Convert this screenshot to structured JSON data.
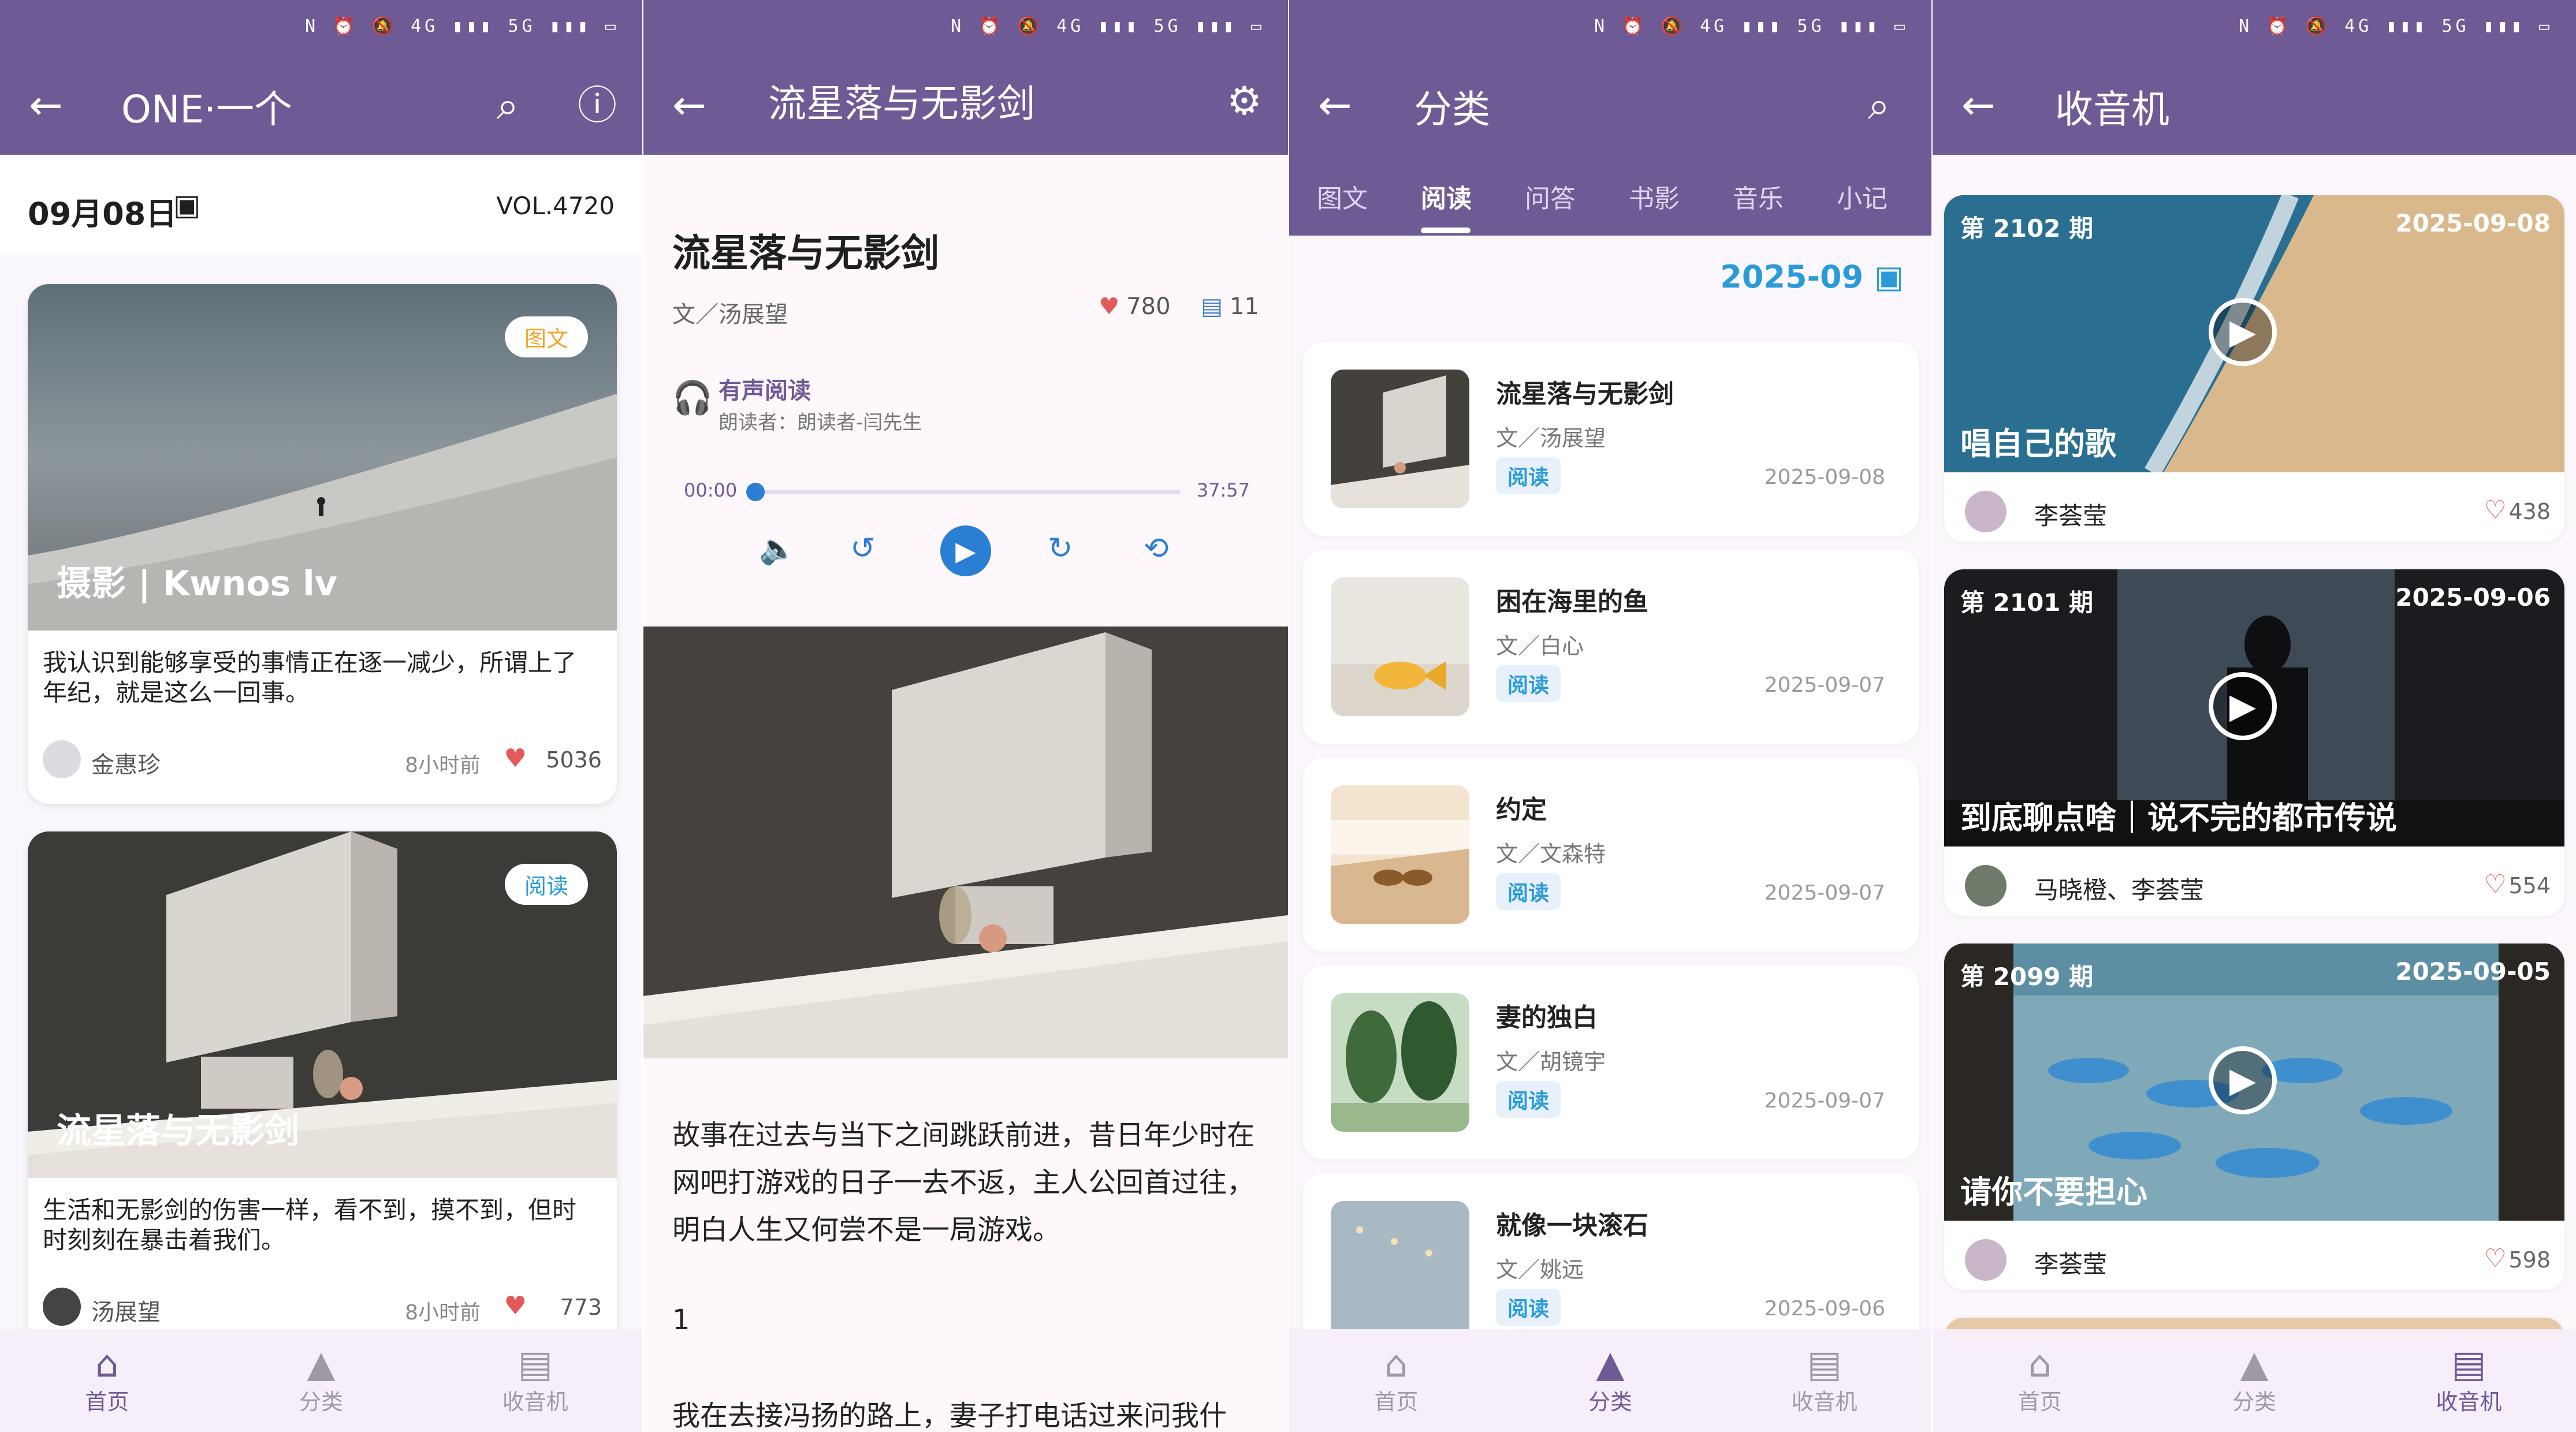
{
  "status_icons": "N ⏰ 🔕 4G ▮▮▮ 5G ▮▮▮ ▭",
  "nav": {
    "home": "首页",
    "category": "分类",
    "radio": "收音机"
  },
  "panel1": {
    "title": "ONE·一个",
    "date": "09月08日",
    "vol": "VOL.4720",
    "cards": [
      {
        "tag": "图文",
        "title": "摄影 | Kwnos lv",
        "desc": "我认识到能够享受的事情正在逐一减少，所谓上了年纪，就是这么一回事。",
        "author": "金惠珍",
        "time": "8小时前",
        "likes": "5036"
      },
      {
        "tag": "阅读",
        "title": "流星落与无影剑",
        "desc": "生活和无影剑的伤害一样，看不到，摸不到，但时时刻刻在暴击着我们。",
        "author": "汤展望",
        "time": "8小时前",
        "likes": "773"
      }
    ]
  },
  "panel2": {
    "title": "流星落与无影剑",
    "article_title": "流星落与无影剑",
    "byline": "文／汤展望",
    "likes": "780",
    "comments": "11",
    "audio_label": "有声阅读",
    "reader": "朗读者：朗读者-闫先生",
    "time_start": "00:00",
    "time_end": "37:57",
    "progress": 0,
    "body": "故事在过去与当下之间跳跃前进，昔日年少时在网吧打游戏的日子一去不返，主人公回首过往，明白人生又何尝不是一局游戏。",
    "section": "1",
    "body2": "我在去接冯扬的路上，妻子打电话过来问我什"
  },
  "panel3": {
    "title": "分类",
    "tabs": [
      "图文",
      "阅读",
      "问答",
      "书影",
      "音乐",
      "小记"
    ],
    "active_tab": "阅读",
    "month": "2025-09",
    "items": [
      {
        "title": "流星落与无影剑",
        "author": "文／汤展望",
        "badge": "阅读",
        "date": "2025-09-08"
      },
      {
        "title": "困在海里的鱼",
        "author": "文／白心",
        "badge": "阅读",
        "date": "2025-09-07"
      },
      {
        "title": "约定",
        "author": "文／文森特",
        "badge": "阅读",
        "date": "2025-09-07"
      },
      {
        "title": "妻的独白",
        "author": "文／胡镜宇",
        "badge": "阅读",
        "date": "2025-09-07"
      },
      {
        "title": "就像一块滚石",
        "author": "文／姚远",
        "badge": "阅读",
        "date": "2025-09-06"
      }
    ]
  },
  "panel4": {
    "title": "收音机",
    "items": [
      {
        "issue": "第 2102 期",
        "date": "2025-09-08",
        "title": "唱自己的歌",
        "host": "李荟莹",
        "likes": "438"
      },
      {
        "issue": "第 2101 期",
        "date": "2025-09-06",
        "title": "到底聊点啥｜说不完的都市传说",
        "host": "马晓橙、李荟莹",
        "likes": "554"
      },
      {
        "issue": "第 2099 期",
        "date": "2025-09-05",
        "title": "请你不要担心",
        "host": "李荟莹",
        "likes": "598"
      }
    ]
  },
  "colors": {
    "primary": "#6e5a95",
    "accent_blue": "#2a9bd8",
    "heart": "#e25a5a",
    "tag_orange": "#f2a52a"
  }
}
